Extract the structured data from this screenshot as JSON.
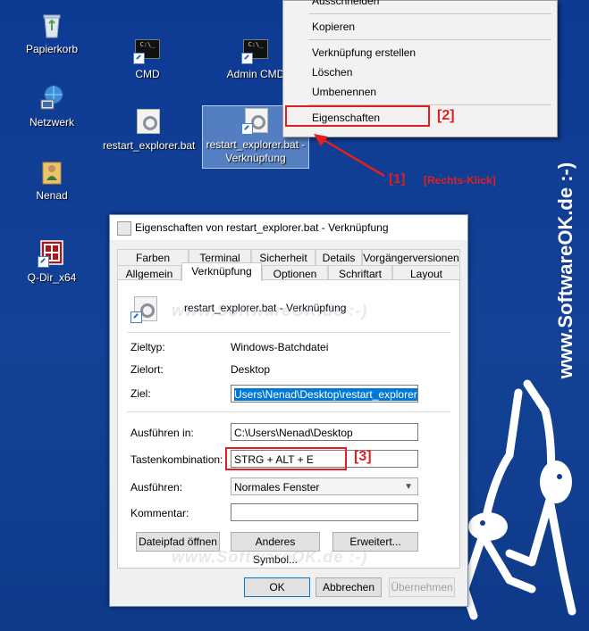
{
  "desktop": {
    "icons": [
      {
        "label": "Papierkorb",
        "icon": "recycle-bin-icon"
      },
      {
        "label": "Netzwerk",
        "icon": "network-icon"
      },
      {
        "label": "Nenad",
        "icon": "user-folder-icon"
      },
      {
        "label": "Q-Dir_x64",
        "icon": "qdir-icon"
      },
      {
        "label": "CMD",
        "icon": "cmd-icon"
      },
      {
        "label": "Admin CMD",
        "icon": "cmd-icon"
      },
      {
        "label": "restart_explorer.bat",
        "icon": "batch-file-icon"
      },
      {
        "label": "restart_explorer.bat - Verknüpfung",
        "icon": "batch-shortcut-icon"
      }
    ]
  },
  "context_menu": {
    "items": [
      {
        "label": "Ausschneiden"
      },
      {
        "label": "Kopieren"
      },
      {
        "label": "Verknüpfung erstellen"
      },
      {
        "label": "Löschen"
      },
      {
        "label": "Umbenennen"
      },
      {
        "label": "Eigenschaften"
      }
    ]
  },
  "annotations": {
    "step1": "[1]",
    "step1_text": "[Rechts-Klick]",
    "step2": "[2]",
    "step3": "[3]",
    "color": "#e02020"
  },
  "watermark": {
    "vertical": "www.SoftwareOK.de :-)",
    "inline": "www.SoftwareOK.de :-)"
  },
  "dialog": {
    "title": "Eigenschaften von restart_explorer.bat - Verknüpfung",
    "tabs_top": [
      "Farben",
      "Terminal",
      "Sicherheit",
      "Details",
      "Vorgängerversionen"
    ],
    "tabs_bottom": [
      "Allgemein",
      "Verknüpfung",
      "Optionen",
      "Schriftart",
      "Layout"
    ],
    "active_tab": "Verknüpfung",
    "file_name": "restart_explorer.bat - Verknüpfung",
    "fields": {
      "zieltyp_label": "Zieltyp:",
      "zieltyp_value": "Windows-Batchdatei",
      "zielort_label": "Zielort:",
      "zielort_value": "Desktop",
      "ziel_label": "Ziel:",
      "ziel_value": "Users\\Nenad\\Desktop\\restart_explorer.bat",
      "ausfuehren_in_label": "Ausführen in:",
      "ausfuehren_in_value": "C:\\Users\\Nenad\\Desktop",
      "tastenkombination_label": "Tastenkombination:",
      "tastenkombination_value": "STRG + ALT + E",
      "ausfuehren_label": "Ausführen:",
      "ausfuehren_value": "Normales Fenster",
      "kommentar_label": "Kommentar:",
      "kommentar_value": ""
    },
    "buttons": {
      "dateipfad": "Dateipfad öffnen",
      "symbol": "Anderes Symbol...",
      "erweitert": "Erweitert...",
      "ok": "OK",
      "abbrechen": "Abbrechen",
      "uebernehmen": "Übernehmen"
    }
  }
}
